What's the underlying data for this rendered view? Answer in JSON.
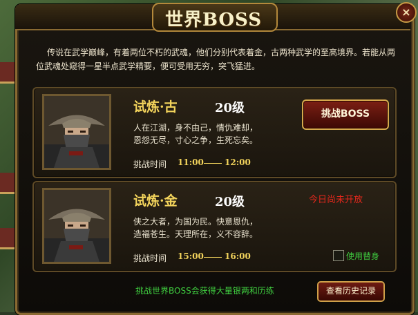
{
  "title": "世界BOSS",
  "close_label": "×",
  "intro": "传说在武学巅峰，有着两位不朽的武魂，他们分别代表着金，古两种武学的至高境界。若能从两位武魂处窥得一星半点武学精要，便可受用无穷，突飞猛进。",
  "bosses": [
    {
      "name": "试炼·古",
      "level": "20级",
      "desc_line1": "人在江湖，身不由己，情仇难却，",
      "desc_line2": "恩怨无尽，寸心之争，生死忘矣。",
      "time_label": "挑战时间",
      "time_start": "11:00",
      "time_end": "12:00",
      "action_label": "挑战BOSS"
    },
    {
      "name": "试炼·金",
      "level": "20级",
      "desc_line1": "侠之大者，为国为民。快意恩仇，",
      "desc_line2": "造福苍生。天理所在，义不容辞。",
      "time_label": "挑战时间",
      "time_start": "15:00",
      "time_end": "16:00",
      "status_text": "今日尚未开放",
      "substitute_label": "使用替身",
      "substitute_checked": false
    }
  ],
  "footer_tip": "挑战世界BOSS会获得大量银两和历练",
  "history_button": "查看历史记录",
  "icons": {
    "close": "close-icon",
    "portrait": "boss-portrait-icon",
    "checkbox": "checkbox-icon"
  },
  "colors": {
    "gold_text": "#f3d45c",
    "red_status": "#e5271c",
    "green_text": "#3ec73e"
  }
}
